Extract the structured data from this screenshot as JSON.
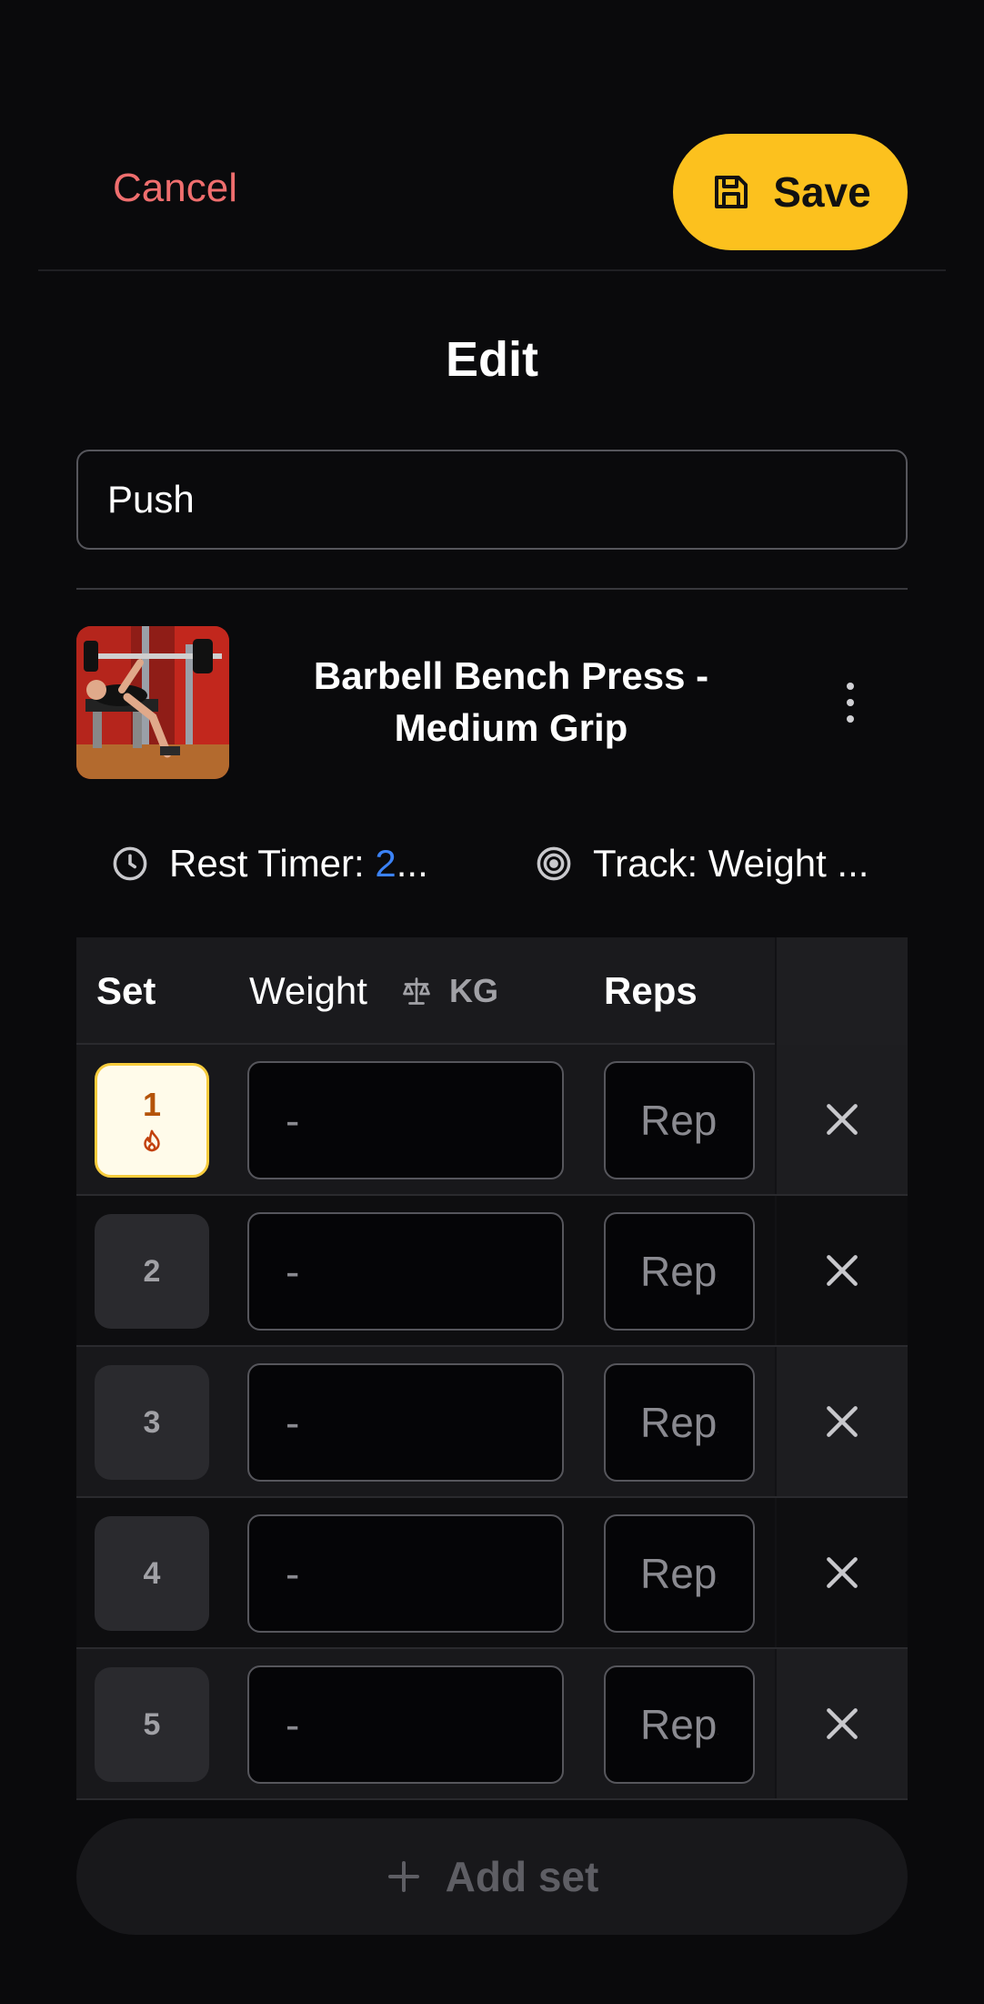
{
  "header": {
    "cancel_label": "Cancel",
    "save_label": "Save",
    "save_color": "#fcc11e",
    "cancel_color": "#ef6e6e"
  },
  "page": {
    "title": "Edit"
  },
  "routine": {
    "name_value": "Push"
  },
  "exercise": {
    "name": "Barbell Bench Press - Medium Grip",
    "thumbnail_icon": "bench-press-photo",
    "more_icon": "more-vertical-icon",
    "rest_timer_label": "Rest Timer:",
    "rest_timer_value": "2",
    "rest_timer_ellipsis": "...",
    "track_label": "Track: Weight ...",
    "accent_color": "#3b82f6"
  },
  "table": {
    "headers": {
      "set": "Set",
      "weight": "Weight",
      "unit": "KG",
      "reps": "Reps"
    },
    "rows": [
      {
        "set": "1",
        "type": "warmup",
        "weight": "-",
        "reps_placeholder": "Reps"
      },
      {
        "set": "2",
        "type": "normal",
        "weight": "-",
        "reps_placeholder": "Reps"
      },
      {
        "set": "3",
        "type": "normal",
        "weight": "-",
        "reps_placeholder": "Reps"
      },
      {
        "set": "4",
        "type": "normal",
        "weight": "-",
        "reps_placeholder": "Reps"
      },
      {
        "set": "5",
        "type": "normal",
        "weight": "-",
        "reps_placeholder": "Reps"
      }
    ]
  },
  "add_set_label": "Add set"
}
